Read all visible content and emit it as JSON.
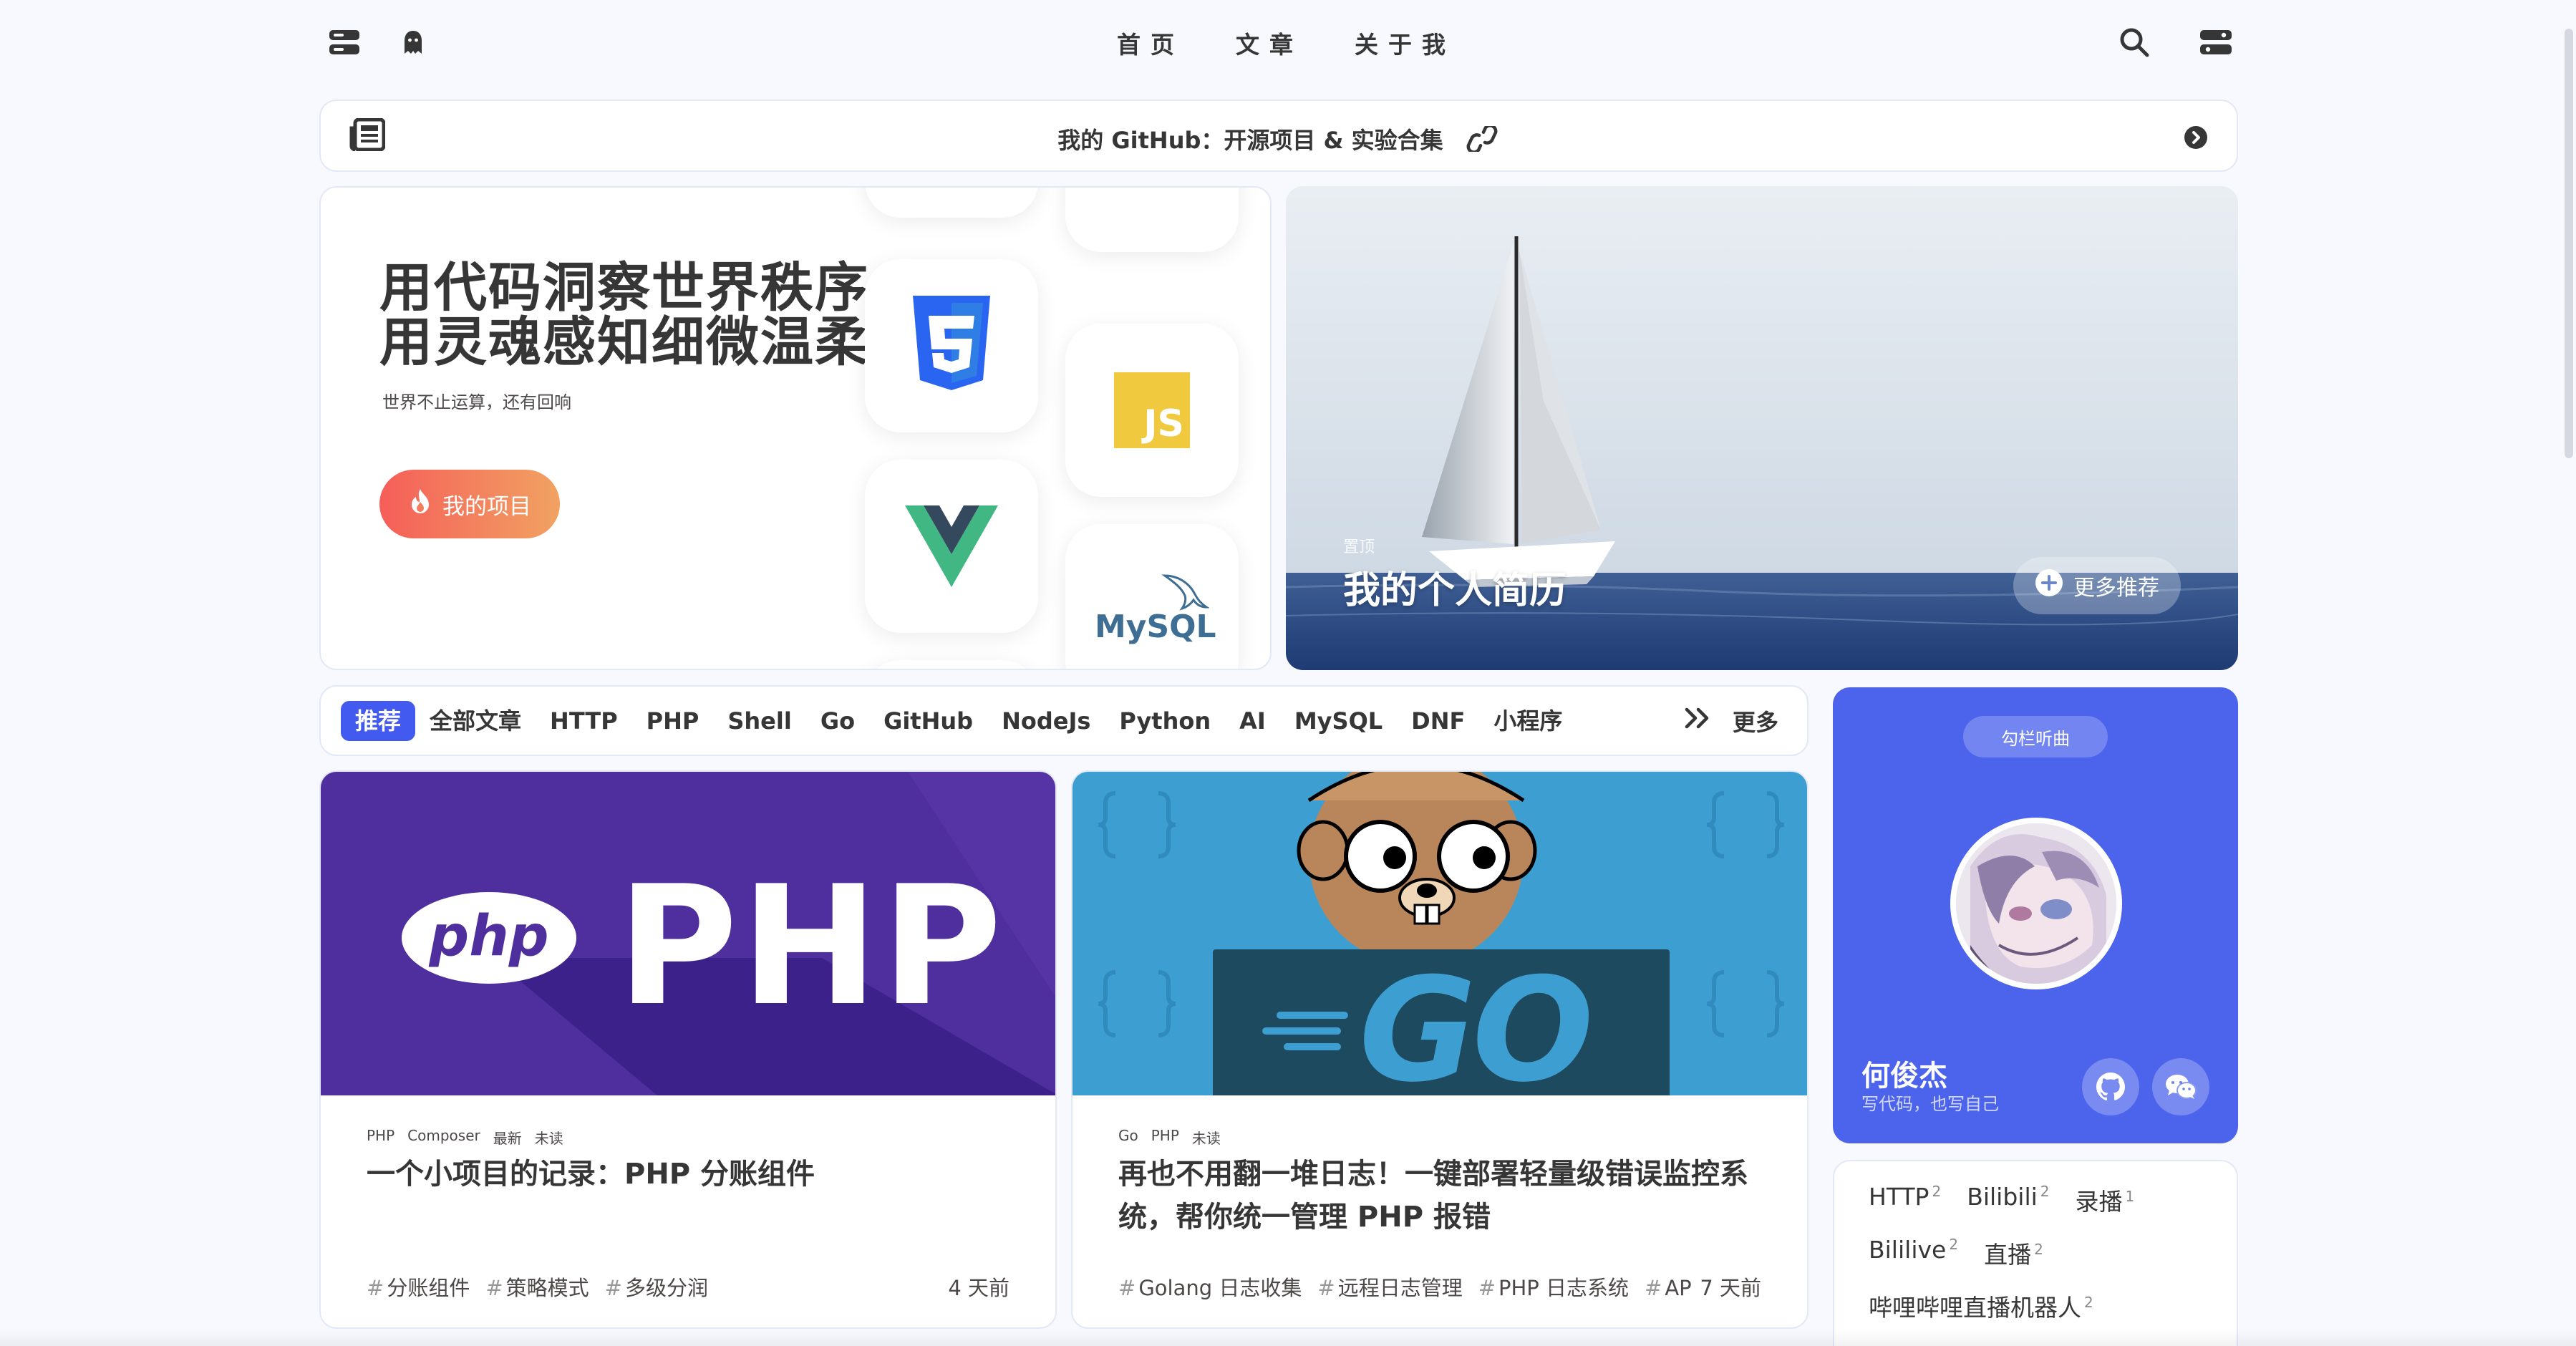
{
  "nav": {
    "left_icons": [
      "menu-grid-icon",
      "ghost-icon"
    ],
    "menu": [
      "首页",
      "文章",
      "关于我"
    ],
    "right_icons": [
      "search-icon",
      "settings-toggle-icon"
    ]
  },
  "bulletin": {
    "text": "我的 GitHub：开源项目 & 实验合集",
    "left_icon": "newspaper-icon",
    "link_icon": "link-icon",
    "right_icon": "chevron-right-circle-icon"
  },
  "hero": {
    "title_line1": "用代码洞察世界秩序",
    "title_line2": "用灵魂感知细微温柔",
    "subtitle": "世界不止运算，还有回响",
    "button": "我的项目",
    "tech_labels": {
      "js": "JS",
      "mysql": "MySQL"
    }
  },
  "recommend": {
    "tag": "置顶",
    "title": "我的个人简历",
    "more": "更多推荐"
  },
  "categories": {
    "items": [
      "推荐",
      "全部文章",
      "HTTP",
      "PHP",
      "Shell",
      "Go",
      "GitHub",
      "NodeJs",
      "Python",
      "AI",
      "MySQL",
      "DNF",
      "小程序"
    ],
    "active_index": 0,
    "more": "更多"
  },
  "posts": [
    {
      "cover_text": "PHP",
      "cover_logo": "php",
      "meta": [
        "PHP",
        "Composer",
        "最新",
        "未读"
      ],
      "title": "一个小项目的记录：PHP 分账组件",
      "tags": [
        "分账组件",
        "策略模式",
        "多级分润"
      ],
      "date": "4 天前"
    },
    {
      "cover_text": "GO",
      "meta": [
        "Go",
        "PHP",
        "未读"
      ],
      "title": "再也不用翻一堆日志！一键部署轻量级错误监控系统，帮你统一管理 PHP 报错",
      "tags": [
        "Golang 日志收集",
        "远程日志管理",
        "PHP 日志系统",
        "API 日志"
      ],
      "date": "7 天前"
    }
  ],
  "author": {
    "badge": "勾栏听曲",
    "name": "何俊杰",
    "desc": "写代码，也写自己",
    "socials": [
      "github-icon",
      "wechat-icon"
    ]
  },
  "tag_cloud": [
    [
      {
        "name": "HTTP",
        "count": "2"
      },
      {
        "name": "Bilibili",
        "count": "2"
      },
      {
        "name": "录播",
        "count": "1"
      }
    ],
    [
      {
        "name": "Bililive",
        "count": "2"
      },
      {
        "name": "直播",
        "count": "2"
      }
    ],
    [
      {
        "name": "哔哩哔哩直播机器人",
        "count": "2"
      }
    ]
  ],
  "colors": {
    "accent": "#425aef",
    "author_bg": "#4c63ec",
    "hero_btn_start": "#f55e59",
    "hero_btn_end": "#f1a262",
    "php_purple": "#4f2e9e",
    "go_blue": "#3d9fd1"
  }
}
